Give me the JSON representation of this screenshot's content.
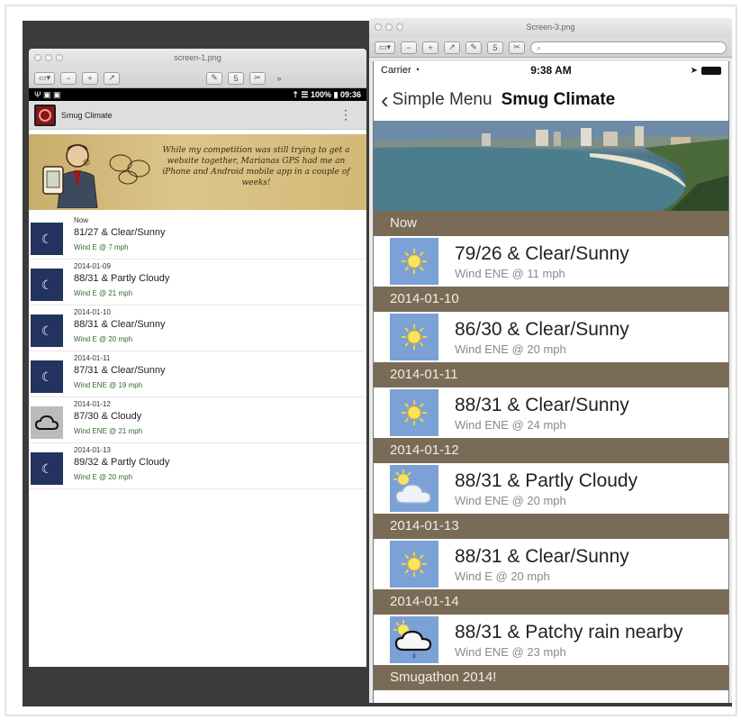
{
  "android_window": {
    "title": "screen-1.png",
    "toolbar": {
      "zoom_out": "−",
      "zoom_in": "+",
      "share": "↗",
      "edit": "✎",
      "rotate": "5",
      "crop": "✂",
      "more": "»"
    },
    "status": {
      "left": "Ψ ▣ ▣",
      "right": "⇡ ☰ 100% ▮ 09:36"
    },
    "app_title": "Smug Climate",
    "overflow": "⋮",
    "banner_text": "While my competition was still trying to get a website together, Marianas GPS had me an iPhone and Android mobile app in a couple of weeks!",
    "items": [
      {
        "date": "Now",
        "main": "81/27 & Clear/Sunny",
        "wind": "Wind E @ 7 mph",
        "icon": "moon-icon",
        "kind": "night"
      },
      {
        "date": "2014-01-09",
        "main": "88/31 & Partly Cloudy",
        "wind": "Wind E @ 21 mph",
        "icon": "moon-icon",
        "kind": "night"
      },
      {
        "date": "2014-01-10",
        "main": "88/31 & Clear/Sunny",
        "wind": "Wind E @ 20 mph",
        "icon": "moon-icon",
        "kind": "night"
      },
      {
        "date": "2014-01-11",
        "main": "87/31 & Clear/Sunny",
        "wind": "Wind ENE @ 19 mph",
        "icon": "moon-icon",
        "kind": "night"
      },
      {
        "date": "2014-01-12",
        "main": "87/30 & Cloudy",
        "wind": "Wind ENE @ 21 mph",
        "icon": "cloud-icon",
        "kind": "cloud"
      },
      {
        "date": "2014-01-13",
        "main": "89/32 & Partly Cloudy",
        "wind": "Wind E @ 20 mph",
        "icon": "moon-icon",
        "kind": "night"
      }
    ],
    "nav": {
      "recent": "▭",
      "home": "⌂",
      "back": "↶",
      "up": "⌃"
    }
  },
  "ios_window": {
    "title": "Screen-3.png",
    "search_placeholder": "",
    "status": {
      "carrier": "Carrier ◔",
      "time": "9:38 AM",
      "location": "➤"
    },
    "nav": {
      "back_label": "Simple Menu",
      "title": "Smug Climate",
      "chevron": "‹"
    },
    "sections": [
      {
        "header": "Now",
        "main": "79/26 & Clear/Sunny",
        "wind": "Wind ENE @ 11 mph",
        "icon": "sun-icon"
      },
      {
        "header": "2014-01-10",
        "main": "86/30 & Clear/Sunny",
        "wind": "Wind ENE @ 20 mph",
        "icon": "sun-icon"
      },
      {
        "header": "2014-01-11",
        "main": "88/31 & Clear/Sunny",
        "wind": "Wind ENE @ 24 mph",
        "icon": "sun-icon"
      },
      {
        "header": "2014-01-12",
        "main": "88/31 & Partly Cloudy",
        "wind": "Wind ENE @ 20 mph",
        "icon": "partly-cloudy-icon"
      },
      {
        "header": "2014-01-13",
        "main": "88/31 & Clear/Sunny",
        "wind": "Wind E @ 20 mph",
        "icon": "sun-icon"
      },
      {
        "header": "2014-01-14",
        "main": "88/31 & Patchy rain nearby",
        "wind": "Wind ENE @ 23 mph",
        "icon": "rain-icon"
      }
    ],
    "footer": "Smugathon 2014!"
  },
  "colors": {
    "ios_header": "#7a6b57",
    "ios_icon_bg": "#7ba1d6",
    "android_night": "#22335f",
    "banner_gold": "#d3b978"
  }
}
